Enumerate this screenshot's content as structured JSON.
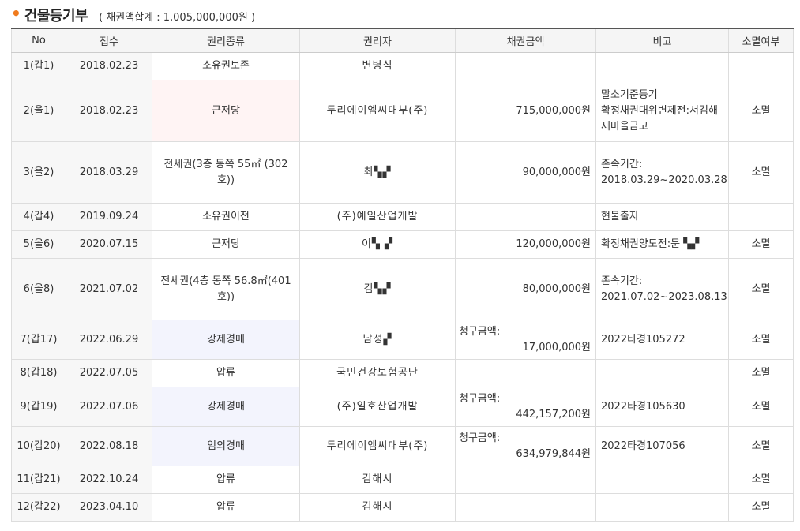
{
  "header": {
    "title": "건물등기부",
    "subtitle": "( 채권액합계 : 1,005,000,000원 )"
  },
  "columns": [
    "No",
    "접수",
    "권리종류",
    "권리자",
    "채권금액",
    "비고",
    "소멸여부"
  ],
  "rows": [
    {
      "no": "1(갑1)",
      "date": "2018.02.23",
      "type": "소유권보존",
      "holder": "변병식",
      "amount_label": "",
      "amount": "",
      "note": "",
      "status": "",
      "highlight": ""
    },
    {
      "no": "2(을1)",
      "date": "2018.02.23",
      "type": "근저당",
      "holder": "두리에이엠씨대부(주)",
      "amount_label": "",
      "amount": "715,000,000원",
      "note": "말소기준등기\n확정채권대위변제전:서김해새마을금고",
      "status": "소멸",
      "highlight": "pink"
    },
    {
      "no": "3(을2)",
      "date": "2018.03.29",
      "type": "전세권(3층 동쪽 55㎡ (302호))",
      "holder": "최▚▞",
      "amount_label": "",
      "amount": "90,000,000원",
      "note": "존속기간:\n2018.03.29~2020.03.28",
      "status": "소멸",
      "highlight": ""
    },
    {
      "no": "4(갑4)",
      "date": "2019.09.24",
      "type": "소유권이전",
      "holder": "(주)예일산업개발",
      "amount_label": "",
      "amount": "",
      "note": "현물출자",
      "status": "",
      "highlight": ""
    },
    {
      "no": "5(을6)",
      "date": "2020.07.15",
      "type": "근저당",
      "holder": "이▚ ▞",
      "amount_label": "",
      "amount": "120,000,000원",
      "note": "확정채권양도전:문 ▚▞",
      "status": "소멸",
      "highlight": ""
    },
    {
      "no": "6(을8)",
      "date": "2021.07.02",
      "type": "전세권(4층 동쪽 56.8㎡(401호))",
      "holder": "김▚▞",
      "amount_label": "",
      "amount": "80,000,000원",
      "note": "존속기간:\n2021.07.02~2023.08.13",
      "status": "소멸",
      "highlight": ""
    },
    {
      "no": "7(갑17)",
      "date": "2022.06.29",
      "type": "강제경매",
      "holder": "남성▞",
      "amount_label": "청구금액:",
      "amount": "17,000,000원",
      "note": "2022타경105272",
      "status": "소멸",
      "highlight": "blue"
    },
    {
      "no": "8(갑18)",
      "date": "2022.07.05",
      "type": "압류",
      "holder": "국민건강보험공단",
      "amount_label": "",
      "amount": "",
      "note": "",
      "status": "소멸",
      "highlight": ""
    },
    {
      "no": "9(갑19)",
      "date": "2022.07.06",
      "type": "강제경매",
      "holder": "(주)일호산업개발",
      "amount_label": "청구금액:",
      "amount": "442,157,200원",
      "note": "2022타경105630",
      "status": "소멸",
      "highlight": "blue"
    },
    {
      "no": "10(갑20)",
      "date": "2022.08.18",
      "type": "임의경매",
      "holder": "두리에이엠씨대부(주)",
      "amount_label": "청구금액:",
      "amount": "634,979,844원",
      "note": "2022타경107056",
      "status": "소멸",
      "highlight": "blue"
    },
    {
      "no": "11(갑21)",
      "date": "2022.10.24",
      "type": "압류",
      "holder": "김해시",
      "amount_label": "",
      "amount": "",
      "note": "",
      "status": "소멸",
      "highlight": ""
    },
    {
      "no": "12(갑22)",
      "date": "2023.04.10",
      "type": "압류",
      "holder": "김해시",
      "amount_label": "",
      "amount": "",
      "note": "",
      "status": "소멸",
      "highlight": ""
    }
  ],
  "colors": {
    "accent_dot": "#f07b1d",
    "header_border": "#555555",
    "highlight_pink": "#fff4f4",
    "highlight_blue": "#f3f4fd"
  }
}
